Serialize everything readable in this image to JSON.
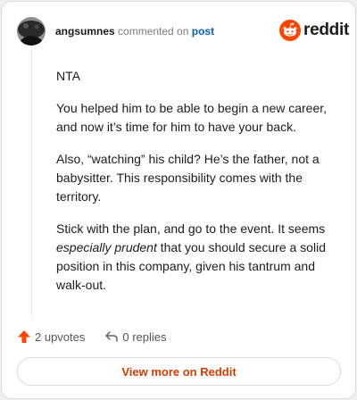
{
  "header": {
    "username": "angsumnes",
    "action_text": "commented on",
    "post_link": "post",
    "brand": "reddit"
  },
  "comment": {
    "p1": "NTA",
    "p2": "You helped him to be able to begin a new career, and now it’s time for him to have your back.",
    "p3": "Also, “watching” his child? He’s the father, not a babysitter. This responsibility comes with the territory.",
    "p4_before": "Stick with the plan, and go to the event. It seems ",
    "p4_emphasis": "especially prudent",
    "p4_after": " that you should secure a solid position in this company, given his tantrum and walk-out."
  },
  "actions": {
    "upvotes": "2 upvotes",
    "replies": "0 replies"
  },
  "footer": {
    "view_more": "View more on Reddit"
  },
  "colors": {
    "accent": "#ff4500",
    "link": "#0a5cc0",
    "view_more": "#d93a00"
  },
  "icons": [
    "snoo-icon",
    "upvote-arrow-icon",
    "reply-arrow-icon"
  ]
}
